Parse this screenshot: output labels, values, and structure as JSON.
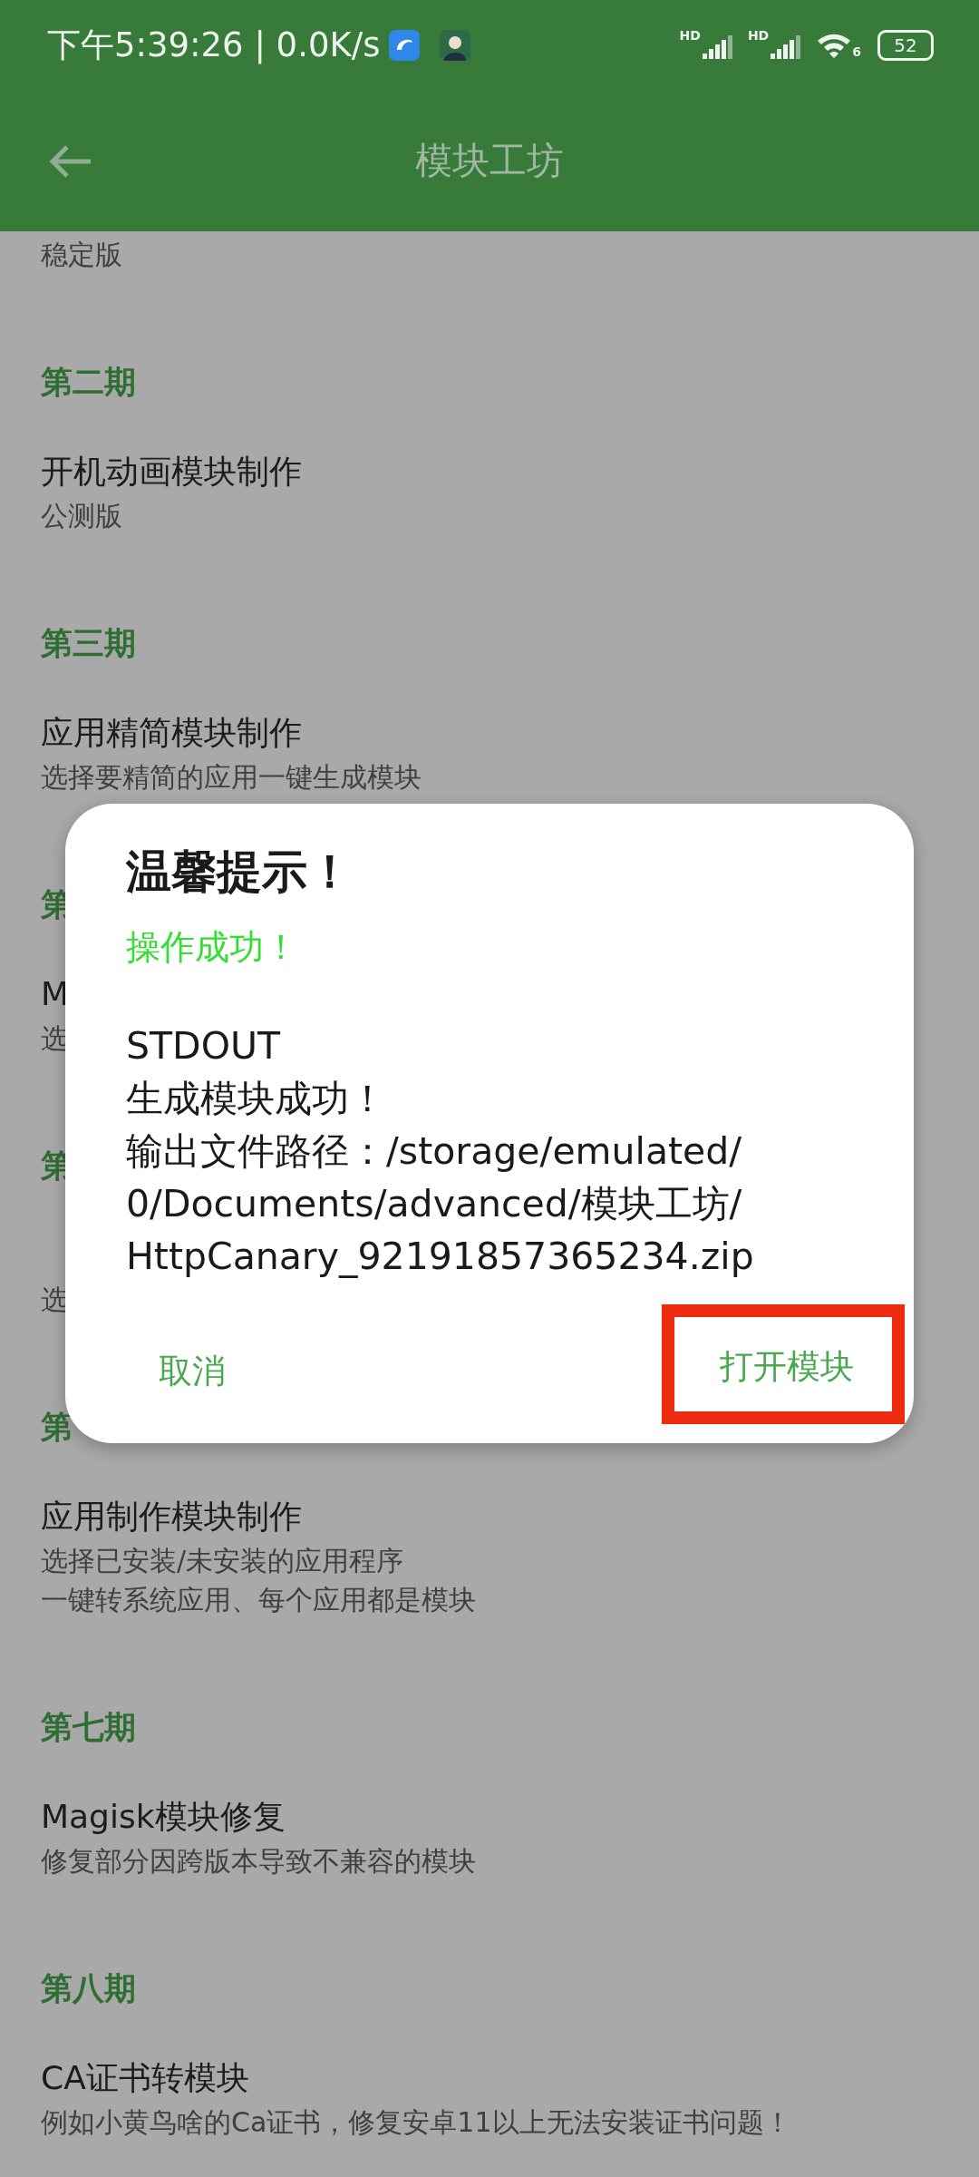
{
  "status_bar": {
    "time": "下午5:39:26 | 0.0K/s",
    "signal_labels": [
      "HD",
      "HD"
    ],
    "wifi_label": "6",
    "battery": "52"
  },
  "app_bar": {
    "title": "模块工坊"
  },
  "list": [
    {
      "kind": "subtitle",
      "text": "稳定版"
    },
    {
      "kind": "header",
      "text": "第二期"
    },
    {
      "kind": "title",
      "text": "开机动画模块制作"
    },
    {
      "kind": "subtitle",
      "text": "公测版"
    },
    {
      "kind": "header",
      "text": "第三期"
    },
    {
      "kind": "title",
      "text": "应用精简模块制作"
    },
    {
      "kind": "subtitle",
      "text": "选择要精简的应用一键生成模块"
    },
    {
      "kind": "header",
      "text": "第"
    },
    {
      "kind": "title",
      "text": "M"
    },
    {
      "kind": "subtitle",
      "text": "选"
    },
    {
      "kind": "header",
      "text": "第"
    },
    {
      "kind": "subtitle",
      "text": "选"
    },
    {
      "kind": "header",
      "text": "第"
    },
    {
      "kind": "title",
      "text": "应用制作模块制作"
    },
    {
      "kind": "subtitle",
      "text": "选择已安装/未安装的应用程序"
    },
    {
      "kind": "subtitle",
      "text": "一键转系统应用、每个应用都是模块"
    },
    {
      "kind": "header",
      "text": "第七期"
    },
    {
      "kind": "title",
      "text": "Magisk模块修复"
    },
    {
      "kind": "subtitle",
      "text": "修复部分因跨版本导致不兼容的模块"
    },
    {
      "kind": "header",
      "text": "第八期"
    },
    {
      "kind": "title",
      "text": "CA证书转模块"
    },
    {
      "kind": "subtitle",
      "text": "例如小黄鸟啥的Ca证书，修复安卓11以上无法安装证书问题！"
    }
  ],
  "dialog": {
    "title": "温馨提示！",
    "message": "操作成功！",
    "body": [
      "STDOUT",
      "生成模块成功！",
      "输出文件路径：/storage/emulated/",
      "0/Documents/advanced/模块工坊/",
      "HttpCanary_92191857365234.zip"
    ],
    "buttons": [
      {
        "label": "取消",
        "highlighted": false
      },
      {
        "label": "打开模块",
        "highlighted": true
      }
    ]
  }
}
